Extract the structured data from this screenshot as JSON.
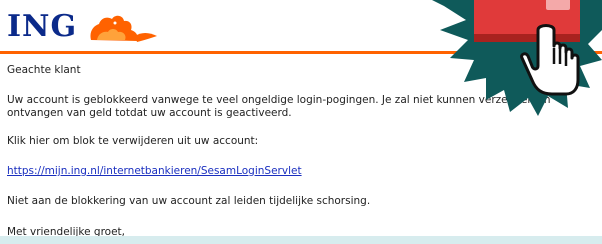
{
  "header": {
    "logo_text": "ING",
    "lion_icon": "ing-lion-logo",
    "accent_color": "#ff6200",
    "brand_blue": "#0b2a8a"
  },
  "message": {
    "greeting": "Geachte klant",
    "main": "Uw account is geblokkeerd vanwege te veel ongeldige login-pogingen. Je zal niet kunnen verzenden en ontvangen van geld totdat uw account is geactiveerd.",
    "instruction": "Klik hier om blok te verwijderen uit uw account:",
    "link_text": "https://mijn.ing.nl/internetbankieren/SesamLoginServlet",
    "warning": "Niet aan de blokkering van uw account zal leiden tijdelijke schorsing.",
    "closing": "Met vriendelijke groet,"
  },
  "overlay": {
    "icon": "pointing-hand-icon",
    "button_color": "#e03a3a",
    "starburst_color": "#0f5a5a"
  }
}
